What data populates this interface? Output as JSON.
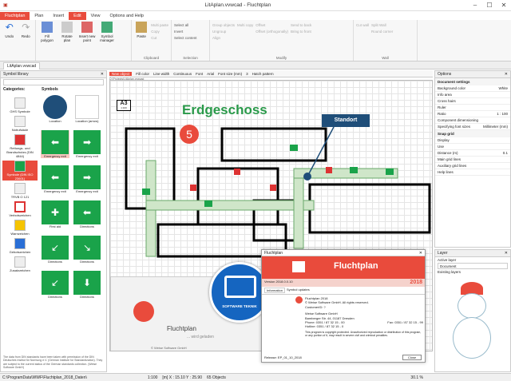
{
  "window": {
    "title": "LitAplan.vvwcad - Fluchtplan",
    "icon_text": "▣"
  },
  "menu": {
    "file": "Fluchtplan",
    "items": [
      "Plan",
      "Insert",
      "Edit",
      "View",
      "Options and Help"
    ],
    "active": "Edit"
  },
  "ribbon": {
    "history": {
      "undo": "Undo",
      "redo": "Redo"
    },
    "insert": {
      "fill_polygon": "Fill polygon",
      "rotate_plan": "Rotate plan",
      "insert_new_point": "Insert new point",
      "symbol_manager": "Symbol manager"
    },
    "clipboard": {
      "paste": "Paste",
      "label": "Clipboard",
      "items": [
        "Multi paste",
        "Copy",
        "Cut"
      ]
    },
    "selection": {
      "label": "Selection",
      "items": [
        "Select all",
        "Invert",
        "Select content"
      ]
    },
    "modify": {
      "label": "Modify",
      "items": [
        "Group objects",
        "Ungroup",
        "Align",
        "Multi copy",
        "Offset",
        "Offset (orthogonally)",
        "Send to back",
        "Bring to front"
      ]
    },
    "wall": {
      "label": "Wall",
      "items": [
        "Cut wall",
        "Split Wall",
        "Round corner"
      ]
    }
  },
  "doc_tab": "LitAplan.vvwcad",
  "symbol_library": {
    "title": "Symbol library",
    "categories_label": "Categories:",
    "symbols_label": "Symbols",
    "categories": [
      "GHS Symbole",
      "Notrufsäule",
      "Rettungs- und Brandschutzs (DIN 4844)",
      "Symbole (DIN ISO 23601)",
      "TRVB O 121",
      "Verbotszeichen",
      "Warnzeichen",
      "Gebotszeichen",
      "Zusatzzeichen"
    ],
    "selected_category": "Symbole (DIN ISO 23601)",
    "symbols": [
      "Location",
      "Location (arrow)",
      "Emergency exit",
      "Emergency exit",
      "Emergency exit",
      "Emergency exit",
      "First aid",
      "Directions",
      "Directions",
      "Directions",
      "Directions",
      "Directions"
    ],
    "footer": "The data from DIN standards have been taken with permission of the DIN Deutsches Institut für Normung e.V. (German Institute for Standardization). They are subject to the current status of the German standards collection. (Weise Software GmbH)"
  },
  "toolbar2": {
    "new_object": "New object",
    "fill_color": "Fill color",
    "line_width": "Line width",
    "line_style": "Continuous",
    "font_label": "Font",
    "font_name": "Arial",
    "font_size": "Font size (mm)",
    "font_size_val": "3",
    "hatch": "Hatch pattern"
  },
  "path": "D:\\Projects\\LitAplan.vvwcad",
  "plan": {
    "title": "Erdgeschoss",
    "scale_box": "A3",
    "scale": "1:100",
    "number": "5",
    "standort": "Standort"
  },
  "options": {
    "title": "Options",
    "section": "Document settings",
    "rows": [
      {
        "k": "Background color",
        "v": "White"
      },
      {
        "k": "Info area",
        "v": ""
      },
      {
        "k": "Cross hairs",
        "v": ""
      },
      {
        "k": "Ruler",
        "v": ""
      },
      {
        "k": "Ratio",
        "v": "1 : 100"
      },
      {
        "k": "Component dimensioning",
        "v": ""
      },
      {
        "k": "Specifying font sizes",
        "v": "Millimeter (mm)"
      }
    ],
    "snap": "Snap grid",
    "snap_rows": [
      {
        "k": "Display",
        "v": ""
      },
      {
        "k": "Use",
        "v": ""
      },
      {
        "k": "Distance (m)",
        "v": "0.1"
      },
      {
        "k": "Main grid lines",
        "v": ""
      },
      {
        "k": "Auxiliary grid lines",
        "v": ""
      }
    ],
    "help_lines": "Help lines"
  },
  "layer": {
    "title": "Layer",
    "active_label": "Active layer",
    "active_value": "Document",
    "existing": "Existing layers"
  },
  "dialog": {
    "title": "Fluchtplan",
    "app_name": "Fluchtplan",
    "year": "2018",
    "version": "Version 2018.0.0.10",
    "tabs": [
      "Information",
      "Symbol updates"
    ],
    "product": "Fluchtplan 2018",
    "copyright": "© Weise Software GmbH. All rights reserved.",
    "customer": "CustomerID: ?",
    "company": "Weise Software GmbH",
    "address": "Bamberger Str. 44, 01187 Dresden",
    "phone": "Phone: 0351 / 87 32 15 - 00",
    "fax": "Fax: 0351 / 87 32 15 - 99",
    "hotline": "Hotline: 0351 / 87 32 15 - 0",
    "warning": "This program is copyright protected. Unauthorized reproduction or distribution of this program, or any portion of it, may result in severe civil and criminal penalties.",
    "release": "Release: EP_01_10_2018",
    "close": "Close"
  },
  "splash": {
    "title": "Fluchtplan",
    "subtitle": "... wird geladen",
    "company": "© Weise Software GmbH"
  },
  "watermark": "SOFTWARE TEKNIK",
  "status": {
    "path": "C:\\ProgramData\\WWF\\Fluchtplan_2018_Daten\\",
    "coords": "[m] X : 15.10 Y : 25.90",
    "objects": "65 Objects",
    "zoom": "30.1 %",
    "scale": "1:100"
  },
  "colors": {
    "accent": "#e94b3c",
    "green": "#1aa34a",
    "plan_title": "#2a9a4a"
  }
}
